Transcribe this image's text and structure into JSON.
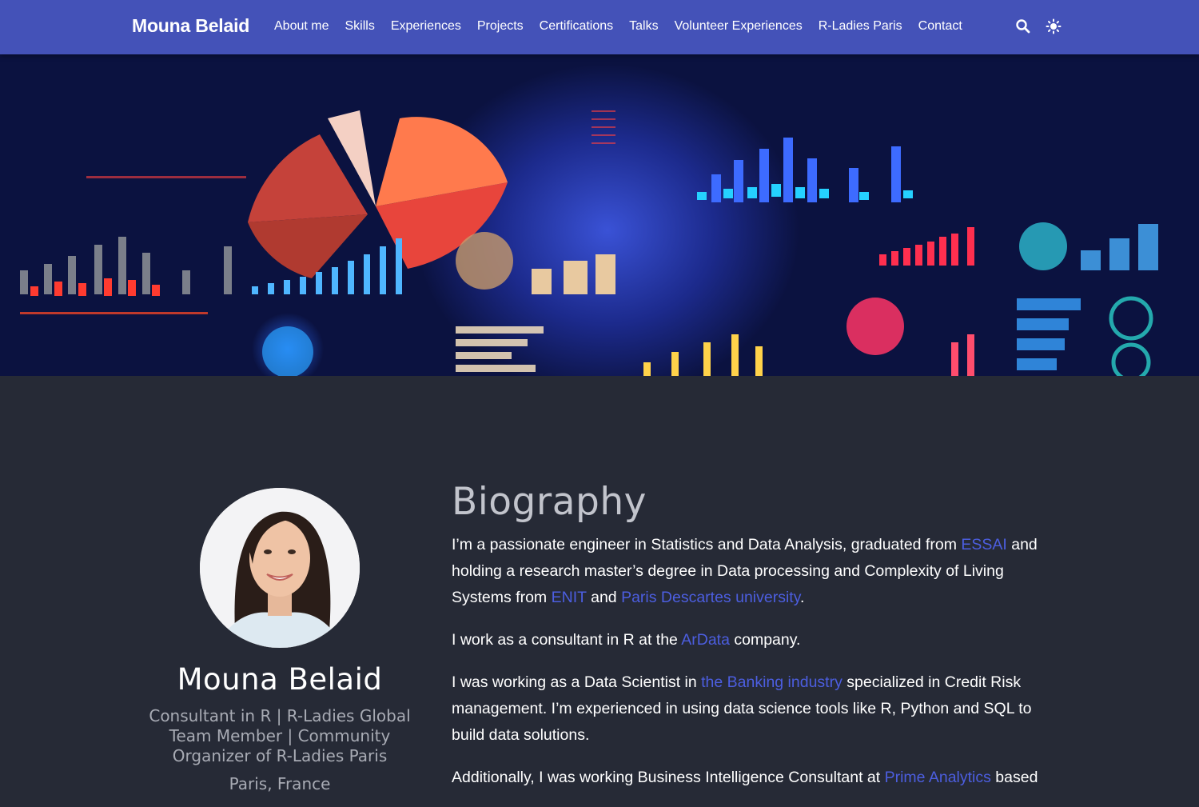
{
  "nav": {
    "brand": "Mouna Belaid",
    "links": [
      "About me",
      "Skills",
      "Experiences",
      "Projects",
      "Certifications",
      "Talks",
      "Volunteer Experiences",
      "R-Ladies Paris",
      "Contact"
    ],
    "icons": [
      "search-icon",
      "theme-toggle-icon"
    ]
  },
  "colors": {
    "navbar": "#4452b8",
    "background": "#262a36",
    "link": "#4c5ee0",
    "muted_text": "#a8abb4"
  },
  "profile": {
    "name": "Mouna Belaid",
    "role": "Consultant in R | R-Ladies Global Team Member | Community Organizer of R-Ladies Paris",
    "location": "Paris, France"
  },
  "bio": {
    "title": "Biography",
    "p1": {
      "t1": "I’m a passionate engineer in Statistics and Data Analysis, graduated from ",
      "link1": "ESSAI",
      "t2": " and holding a research master’s degree in Data processing and Complexity of Living Systems from ",
      "link2": "ENIT",
      "t3": " and ",
      "link3": "Paris Descartes university",
      "t4": "."
    },
    "p2": {
      "t1": "I work as a consultant in R at the ",
      "link1": "ArData",
      "t2": " company."
    },
    "p3": {
      "t1": "I was working as a Data Scientist in ",
      "link1": "the Banking industry",
      "t2": " specialized in Credit Risk management. I’m experienced in using data science tools like R, Python and SQL to build data solutions."
    },
    "p4": {
      "t1": "Additionally, I was working Business Intelligence Consultant at ",
      "link1": "Prime Analytics",
      "t2": " based"
    }
  }
}
